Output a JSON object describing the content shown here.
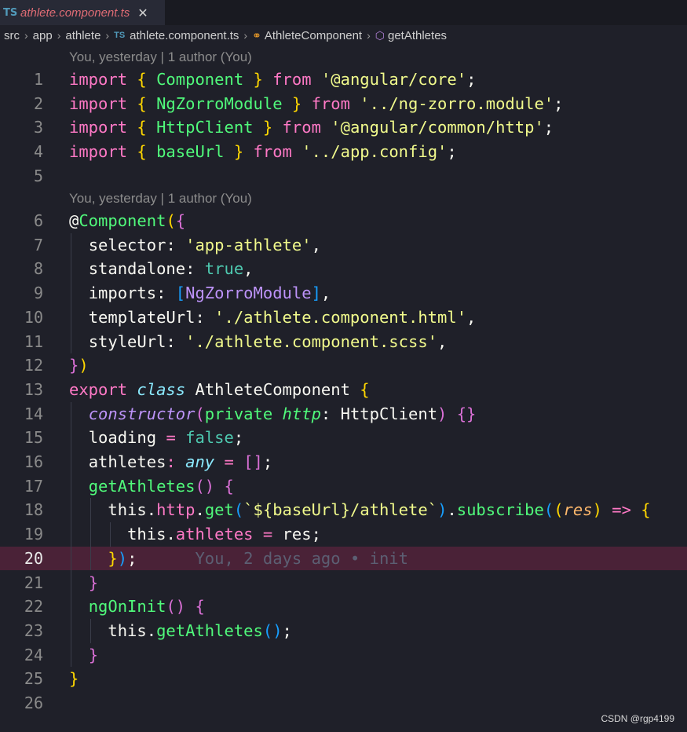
{
  "tab": {
    "badge": "TS",
    "title": "athlete.component.ts",
    "close": "✕"
  },
  "breadcrumb": {
    "items": [
      "src",
      "app",
      "athlete",
      "athlete.component.ts",
      "AthleteComponent",
      "getAthletes"
    ],
    "ts_badge": "TS"
  },
  "blame": {
    "top": "You, yesterday | 1 author (You)",
    "middle": "You, yesterday | 1 author (You)"
  },
  "line_numbers": [
    "1",
    "2",
    "3",
    "4",
    "5",
    "6",
    "7",
    "8",
    "9",
    "10",
    "11",
    "12",
    "13",
    "14",
    "15",
    "16",
    "17",
    "18",
    "19",
    "20",
    "21",
    "22",
    "23",
    "24",
    "25",
    "26"
  ],
  "code": {
    "import_kw": "import",
    "from_kw": "from",
    "l1_name": "Component",
    "l1_src": "'@angular/core'",
    "l2_name": "NgZorroModule",
    "l2_src": "'../ng-zorro.module'",
    "l3_name": "HttpClient",
    "l3_src": "'@angular/common/http'",
    "l4_name": "baseUrl",
    "l4_src": "'../app.config'",
    "decorator_at": "@",
    "decorator": "Component",
    "selector_key": "selector",
    "selector_val": "'app-athlete'",
    "standalone_key": "standalone",
    "true_val": "true",
    "imports_key": "imports",
    "imports_val": "NgZorroModule",
    "template_key": "templateUrl",
    "template_val": "'./athlete.component.html'",
    "style_key": "styleUrl",
    "style_val": "'./athlete.component.scss'",
    "export_kw": "export",
    "class_kw": "class",
    "class_name": "AthleteComponent",
    "constructor": "constructor",
    "private_kw": "private",
    "http_param": "http",
    "http_type": "HttpClient",
    "loading": "loading",
    "false_val": "false",
    "athletes": "athletes",
    "any_type": "any",
    "get_fn": "getAthletes",
    "this_kw": "this",
    "http_prop": "http",
    "get_method": "get",
    "tpl_open": "`${",
    "tpl_var": "baseUrl",
    "tpl_close": "}",
    "tpl_rest": "/athlete`",
    "subscribe": "subscribe",
    "res": "res",
    "arrow": "=>",
    "athletes_prop": "athletes",
    "res_val": "res",
    "ghost_text": "You, 2 days ago • init",
    "ng_on_init": "ngOnInit"
  },
  "watermark": "CSDN @rgp4199",
  "colors": {
    "background": "#1f2029",
    "current_line": "#4a2237",
    "keyword": "#ff79c6",
    "string": "#f1fa8c",
    "function": "#50fa7b"
  }
}
